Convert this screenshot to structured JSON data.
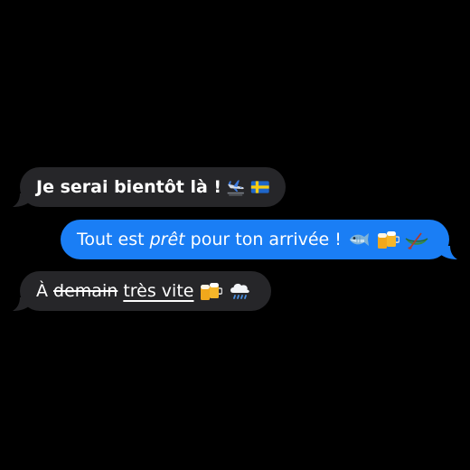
{
  "messages": [
    {
      "direction": "incoming",
      "segments": [
        {
          "text": "Je serai bientôt là !",
          "style": "bold"
        }
      ],
      "emoji_icons": [
        "airplane-arriving-icon",
        "sweden-flag-icon"
      ]
    },
    {
      "direction": "outgoing",
      "segments": [
        {
          "text": "Tout est ",
          "style": "normal"
        },
        {
          "text": "prêt",
          "style": "italic"
        },
        {
          "text": " pour ton arrivée !",
          "style": "normal"
        }
      ],
      "emoji_icons": [
        "fish-icon",
        "beer-mugs-icon",
        "canoe-icon"
      ]
    },
    {
      "direction": "incoming",
      "segments": [
        {
          "text": "À ",
          "style": "normal"
        },
        {
          "text": "demain",
          "style": "strikethrough"
        },
        {
          "text": " ",
          "style": "normal"
        },
        {
          "text": "très vite",
          "style": "underline"
        }
      ],
      "emoji_icons": [
        "beer-mugs-icon",
        "cloud-with-rain-icon"
      ]
    }
  ],
  "colors": {
    "background": "#000000",
    "incoming_bubble": "#262629",
    "outgoing_bubble": "#1a7ef5",
    "text": "#ffffff"
  }
}
